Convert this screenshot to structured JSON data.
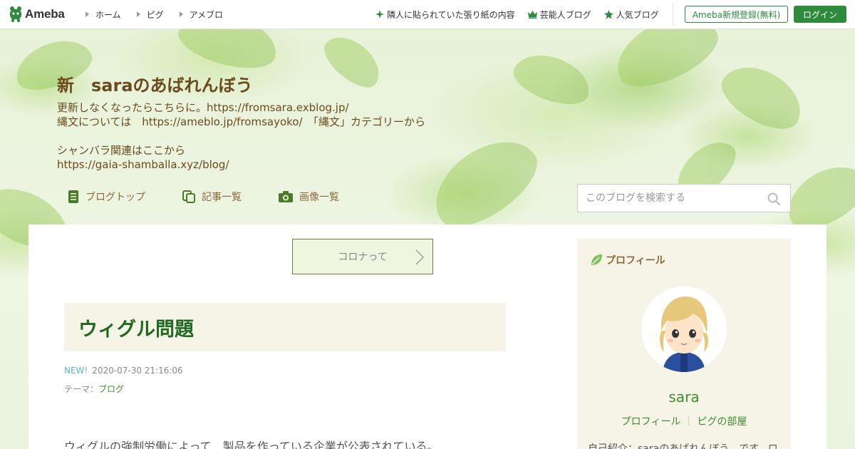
{
  "topbar": {
    "logo_text": "Ameba",
    "nav": [
      "ホーム",
      "ピグ",
      "アメブロ"
    ],
    "right_nav": [
      {
        "label": "隣人に貼られていた張り紙の内容",
        "icon": "sparkle-icon"
      },
      {
        "label": "芸能人ブログ",
        "icon": "crown-icon"
      },
      {
        "label": "人気ブログ",
        "icon": "star-icon"
      }
    ],
    "register_label": "Ameba新規登録(無料)",
    "login_label": "ログイン",
    "accent_color": "#2d8c3c"
  },
  "blog": {
    "title": "新　saraのあばれんぼう",
    "description": "更新しなくなったらこちらに。https://fromsara.exblog.jp/\n縄文については　https://ameblo.jp/fromsayoko/　「縄文」カテゴリーから\n\nシャンバラ関連はここから\nhttps://gaia-shamballa.xyz/blog/",
    "nav": [
      {
        "label": "ブログトップ",
        "icon": "document-icon"
      },
      {
        "label": "記事一覧",
        "icon": "copy-icon"
      },
      {
        "label": "画像一覧",
        "icon": "camera-icon"
      }
    ],
    "search_placeholder": "このブログを検索する"
  },
  "entry": {
    "prev_label": "コロナって",
    "title": "ウィグル問題",
    "new_badge": "NEW!",
    "datetime": "2020-07-30 21:16:06",
    "theme_prefix": "テーマ：",
    "theme": "ブログ",
    "body_first_line": "ウィグルの強制労働によって　製品を作っている企業が公表されている。"
  },
  "sidebar": {
    "heading": "プロフィール",
    "name": "sara",
    "links": [
      "プロフィール",
      "ピグの部屋"
    ],
    "intro": "自己紹介：saraのあばれんぼう　です。ロ"
  }
}
